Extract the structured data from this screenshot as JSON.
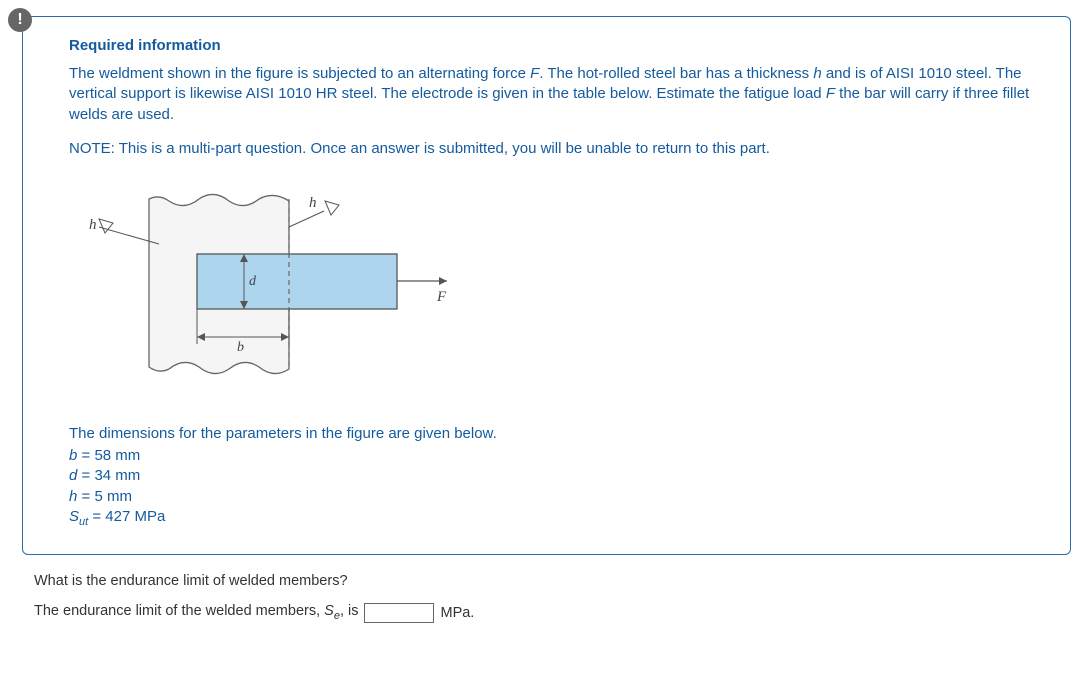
{
  "alert": "!",
  "req_title": "Required information",
  "body_p1_a": "The weldment shown in the figure is subjected to an alternating force ",
  "body_p1_F": "F",
  "body_p1_b": ". The hot-rolled steel bar has a thickness ",
  "body_p1_h": "h",
  "body_p1_c": " and is of AISI 1010 steel. The vertical support is likewise AISI 1010 HR steel. The electrode is given in the table below. Estimate the fatigue load ",
  "body_p1_F2": "F",
  "body_p1_d": " the bar will carry if three fillet welds are used.",
  "note": "NOTE: This is a multi-part question. Once an answer is submitted, you will be unable to return to this part.",
  "dims_title": "The dimensions for the parameters in the figure are given below.",
  "dims": {
    "b_label": "b",
    "b_val": " = 58 mm",
    "d_label": "d",
    "d_val": " = 34 mm",
    "h_label": "h",
    "h_val": " = 5 mm",
    "S_label": "S",
    "S_sub": "ut",
    "S_val": " = 427 MPa"
  },
  "question": "What is the endurance limit of welded members?",
  "answer_a": "The endurance limit of the welded members, ",
  "answer_S": "S",
  "answer_sub": "e",
  "answer_comma": ",",
  "answer_b": " is ",
  "answer_unit": " MPa.",
  "figure": {
    "h": "h",
    "d": "d",
    "b": "b",
    "F": "F"
  }
}
